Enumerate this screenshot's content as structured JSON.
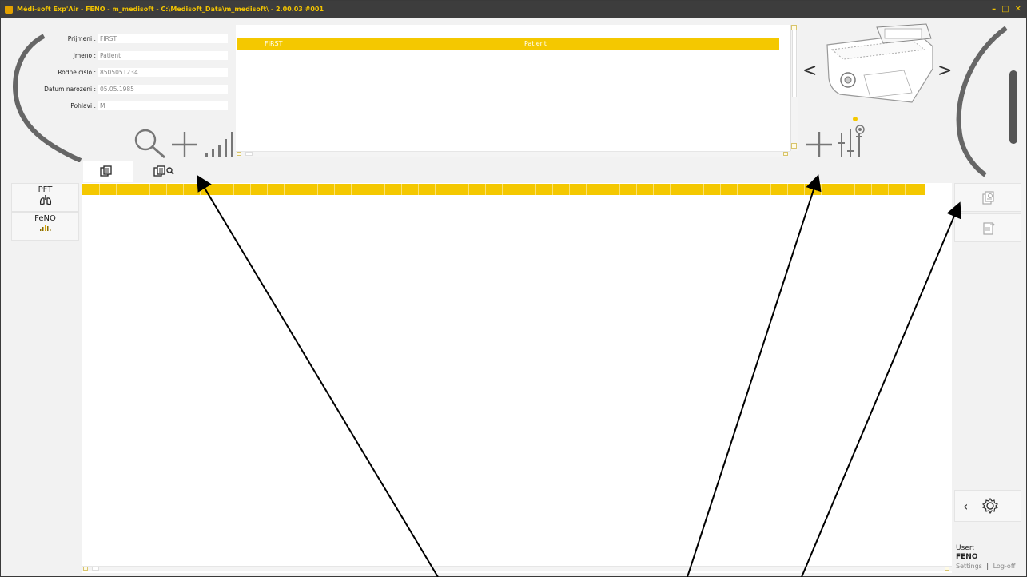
{
  "window": {
    "title": "Médi-soft Exp'Air - FENO - m_medisoft - C:\\Medisoft_Data\\m_medisoft\\ - 2.00.03 #001",
    "controls": [
      "–",
      "□",
      "✕"
    ]
  },
  "patient_form": {
    "fields": [
      {
        "label": "Prijmeni :",
        "value": "FIRST"
      },
      {
        "label": "Jmeno :",
        "value": "Patient"
      },
      {
        "label": "Rodne cislo :",
        "value": "8505051234"
      },
      {
        "label": "Datum narozeni :",
        "value": "05.05.1985"
      },
      {
        "label": "Pohlavi :",
        "value": "M"
      }
    ]
  },
  "patient_list": {
    "rows": [
      {
        "last_name": "FIRST",
        "first_name": "Patient"
      }
    ]
  },
  "tools": {
    "search_icon": "magnifier-icon",
    "add_patient_icon": "plus-icon",
    "signal_icon": "signal-bars-icon",
    "add_device_icon": "plus-icon",
    "device_settings_icon": "sliders-icon"
  },
  "device_nav": {
    "prev": "<",
    "next": ">"
  },
  "tabs": [
    {
      "icon": "documents-icon",
      "active": true
    },
    {
      "icon": "documents-search-icon",
      "active": false
    }
  ],
  "left_panel": [
    {
      "label": "PFT",
      "icon": "lungs-icon"
    },
    {
      "label": "FeNO",
      "icon": "bars-icon"
    }
  ],
  "right_panel": {
    "settings_collapse": "‹",
    "settings_icon": "gear-icon"
  },
  "user": {
    "label": "User:",
    "name": "FENO",
    "settings_link": "Settings",
    "separator": "|",
    "logoff_link": "Log-off"
  },
  "colors": {
    "accent": "#f4c800",
    "titlebar": "#3d3d3d",
    "panel_bg": "#f2f2f2"
  }
}
